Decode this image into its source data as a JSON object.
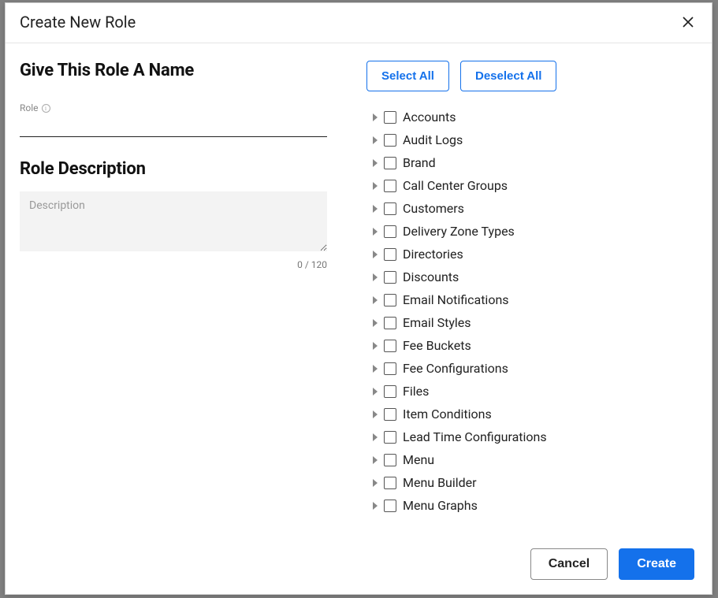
{
  "modal": {
    "title": "Create New Role",
    "left": {
      "name_heading": "Give This Role A Name",
      "role_label": "Role",
      "role_value": "",
      "desc_heading": "Role Description",
      "desc_placeholder": "Description",
      "desc_value": "",
      "char_counter": "0 / 120"
    },
    "right": {
      "select_all": "Select All",
      "deselect_all": "Deselect All",
      "permissions": [
        "Accounts",
        "Audit Logs",
        "Brand",
        "Call Center Groups",
        "Customers",
        "Delivery Zone Types",
        "Directories",
        "Discounts",
        "Email Notifications",
        "Email Styles",
        "Fee Buckets",
        "Fee Configurations",
        "Files",
        "Item Conditions",
        "Lead Time Configurations",
        "Menu",
        "Menu Builder",
        "Menu Graphs"
      ]
    },
    "footer": {
      "cancel": "Cancel",
      "create": "Create"
    }
  }
}
